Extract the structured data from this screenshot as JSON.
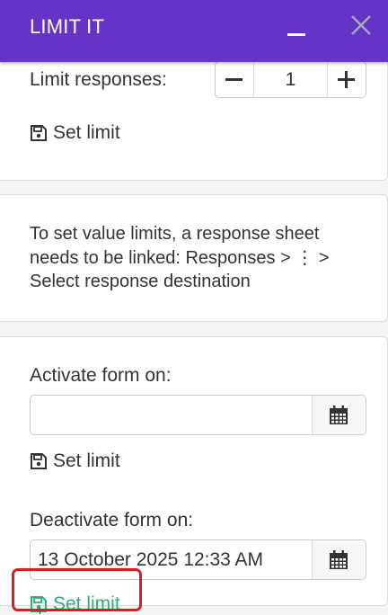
{
  "header": {
    "title": "LIMIT IT",
    "minimize_icon": "minimize-icon",
    "close_icon": "close-icon"
  },
  "responses_limit": {
    "label": "Limit responses:",
    "value": "1",
    "set_limit_label": "Set limit"
  },
  "value_limits": {
    "message": "To set value limits, a response sheet needs to be linked: Responses > ⋮ > Select response destination"
  },
  "activate": {
    "label": "Activate form on:",
    "value": "",
    "set_limit_label": "Set limit"
  },
  "deactivate": {
    "label": "Deactivate form on:",
    "value": "13 October 2025 12:33 AM",
    "set_limit_label": "Set limit"
  },
  "colors": {
    "header": "#6633c7",
    "highlight": "#e01b1b",
    "set_limit_active": "#22b573"
  }
}
